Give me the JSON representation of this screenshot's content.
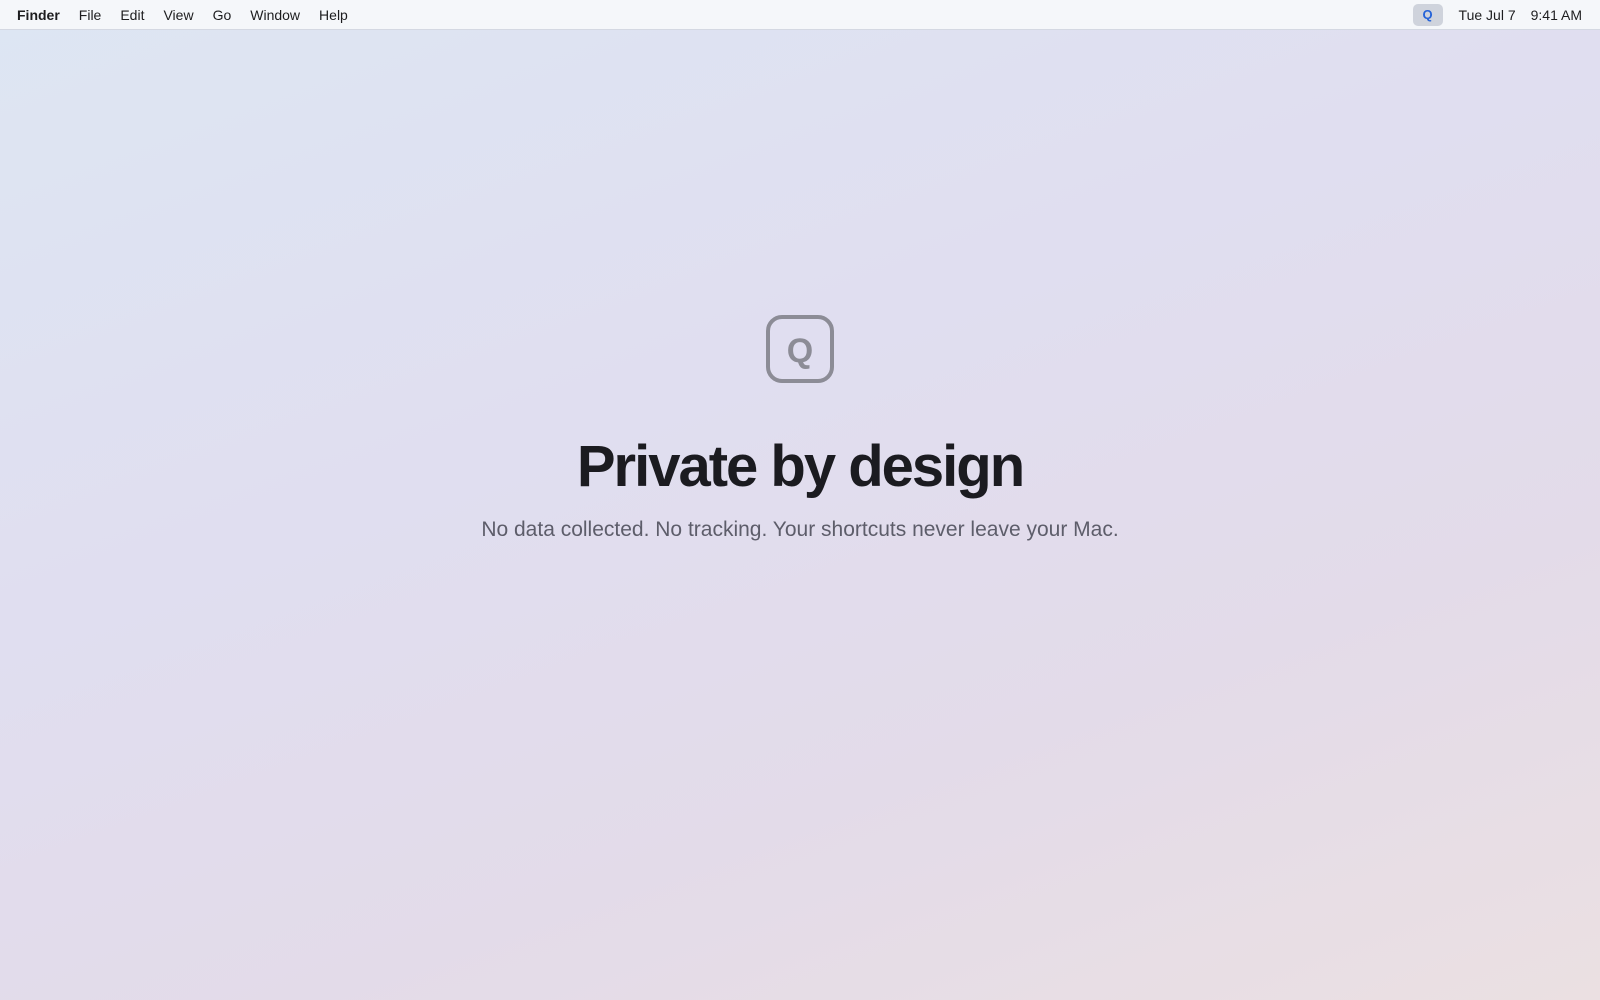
{
  "menubar": {
    "app_name": "Finder",
    "menus": [
      "File",
      "Edit",
      "View",
      "Go",
      "Window",
      "Help"
    ],
    "status_icon_letter": "Q",
    "date": "Tue Jul 7",
    "time": "9:41 AM"
  },
  "hero": {
    "logo_letter": "Q",
    "title": "Private by design",
    "subtitle": "No data collected. No tracking. Your shortcuts never leave your Mac."
  },
  "colors": {
    "accent": "#2563d8",
    "logo_gray": "#8c8c96",
    "title": "#1b1b20",
    "subtitle": "#5d5d6a"
  },
  "icons": {
    "status": "app-status-icon",
    "logo": "app-logo-icon"
  }
}
